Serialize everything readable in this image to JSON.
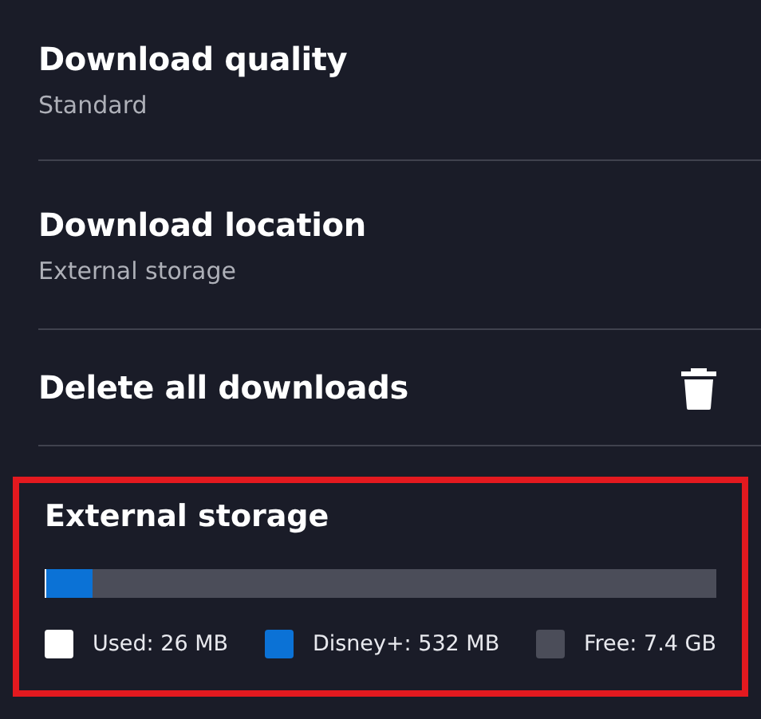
{
  "settings": [
    {
      "kind": "option",
      "title": "Download quality",
      "value": "Standard"
    },
    {
      "kind": "option",
      "title": "Download location",
      "value": "External storage"
    },
    {
      "kind": "action",
      "title": "Delete all downloads"
    }
  ],
  "storage": {
    "title": "External storage",
    "highlighted": true,
    "items": [
      {
        "kind": "segment",
        "label": "Used: 26 MB",
        "color": "#ffffff",
        "level": 0.003
      },
      {
        "kind": "segment",
        "label": "Disney+: 532 MB",
        "color": "#0b72d6",
        "level": 0.068
      },
      {
        "kind": "track",
        "label": "Free: 7.4 GB",
        "color": "#4b4d59"
      }
    ]
  }
}
